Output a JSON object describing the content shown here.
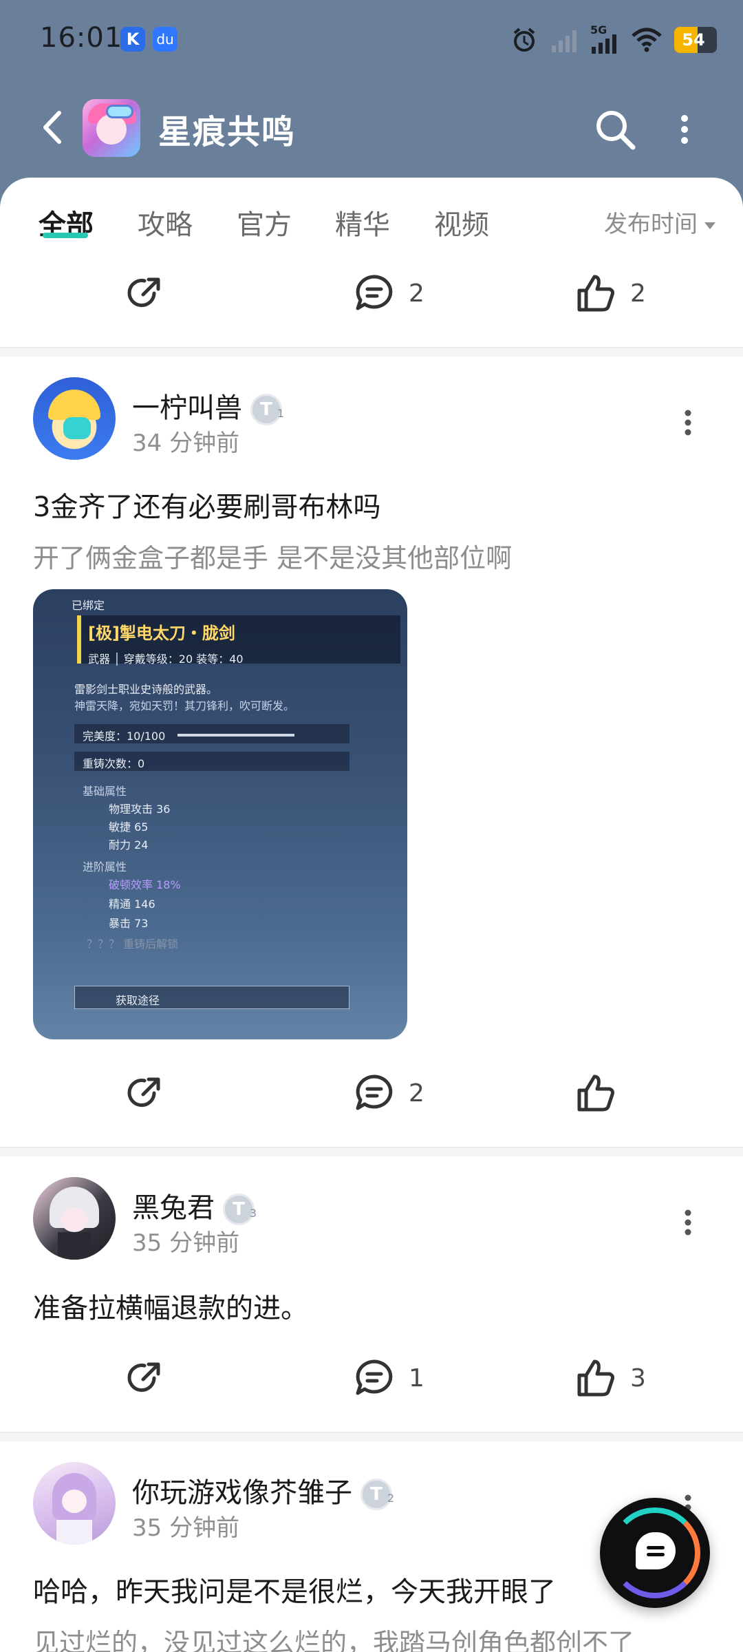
{
  "status_bar": {
    "time": "16:01",
    "app_k": "K",
    "app_b": "du",
    "network": "5G",
    "battery": "54"
  },
  "header": {
    "title": "星痕共鸣"
  },
  "tabs": [
    {
      "label": "全部",
      "active": true
    },
    {
      "label": "攻略",
      "active": false
    },
    {
      "label": "官方",
      "active": false
    },
    {
      "label": "精华",
      "active": false
    },
    {
      "label": "视频",
      "active": false
    }
  ],
  "sort": {
    "label": "发布时间"
  },
  "prev_post_actions": {
    "comments": "2",
    "likes": "2"
  },
  "posts": [
    {
      "username": "一柠叫兽",
      "level": "1",
      "time": "34 分钟前",
      "title": "3金齐了还有必要刷哥布林吗",
      "body": "开了俩金盒子都是手 是不是没其他部位啊",
      "comments": "2",
      "likes": "",
      "image": {
        "tag": "已绑定",
        "item_name": "[极]掣电太刀・胧剑",
        "meta": "武器 │ 穿戴等级：20  装等：40",
        "desc1": "雷影剑士职业史诗般的武器。",
        "desc2": "神雷天降，宛如天罚！其刀锋利，吹可断发。",
        "perfect": "完美度：10/100",
        "reforge": "重铸次数：0",
        "base_attr": "基础属性",
        "attr1": "物理攻击 36",
        "attr2": "敏捷 65",
        "attr3": "耐力 24",
        "adv_attr": "进阶属性",
        "attr4": "破顿效率 18%",
        "attr5": "精通 146",
        "attr6": "暴击 73",
        "locked": "？？？ 重铸后解锁",
        "source": "获取途径"
      }
    },
    {
      "username": "黑兔君",
      "level": "3",
      "time": "35 分钟前",
      "title": "准备拉横幅退款的进。",
      "comments": "1",
      "likes": "3"
    },
    {
      "username": "你玩游戏像芥雏子",
      "level": "2",
      "time": "35 分钟前",
      "title": "哈哈，昨天我问是不是很烂，今天我开眼了",
      "body": "见过烂的，没见过这么烂的，我踏马创角色都创不了"
    }
  ],
  "colors": {
    "header_bg": "#6a7f99",
    "tab_accent": "#27c9b2"
  }
}
